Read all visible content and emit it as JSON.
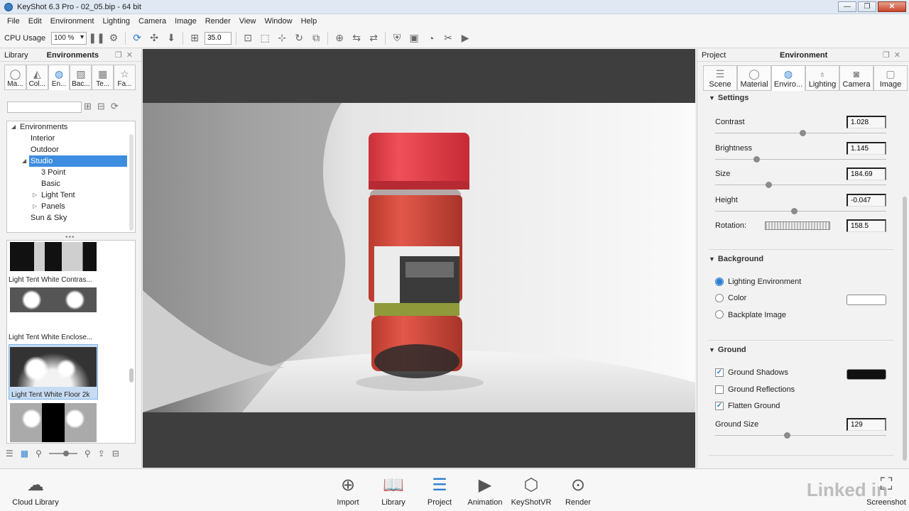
{
  "window": {
    "title": "KeyShot 6.3 Pro  - 02_05.bip  - 64 bit",
    "controls": {
      "minimize": "—",
      "maximize": "❐",
      "close": "✕"
    }
  },
  "menu": [
    "File",
    "Edit",
    "Environment",
    "Lighting",
    "Camera",
    "Image",
    "Render",
    "View",
    "Window",
    "Help"
  ],
  "toolbar": {
    "cpu_label": "CPU Usage",
    "cpu_value": "100 %",
    "focal_value": "35.0"
  },
  "library": {
    "tab_label": "Library",
    "title": "Environments",
    "tabs": [
      {
        "label": "Ma...",
        "icon": "material-icon"
      },
      {
        "label": "Col...",
        "icon": "color-icon"
      },
      {
        "label": "En...",
        "icon": "globe-icon"
      },
      {
        "label": "Bac...",
        "icon": "image-icon"
      },
      {
        "label": "Te...",
        "icon": "texture-icon"
      },
      {
        "label": "Fa...",
        "icon": "star-icon"
      }
    ],
    "search_placeholder": "",
    "tree": [
      {
        "label": "Environments",
        "level": 0,
        "twisty": "◢"
      },
      {
        "label": "Interior",
        "level": 1,
        "twisty": ""
      },
      {
        "label": "Outdoor",
        "level": 1,
        "twisty": ""
      },
      {
        "label": "Studio",
        "level": 1,
        "twisty": "◢",
        "selected": true
      },
      {
        "label": "3 Point",
        "level": 2,
        "twisty": ""
      },
      {
        "label": "Basic",
        "level": 2,
        "twisty": ""
      },
      {
        "label": "Light Tent",
        "level": 2,
        "twisty": "▷"
      },
      {
        "label": "Panels",
        "level": 2,
        "twisty": "▷"
      },
      {
        "label": "Sun & Sky",
        "level": 1,
        "twisty": ""
      }
    ],
    "thumbnails": [
      {
        "label": "Light Tent White Contras..."
      },
      {
        "label": "Light Tent White Enclose..."
      },
      {
        "label": "Light Tent White Floor 2k"
      }
    ]
  },
  "project": {
    "tab_label": "Project",
    "title": "Environment",
    "tabs": [
      {
        "label": "Scene",
        "icon": "scene-icon"
      },
      {
        "label": "Material",
        "icon": "material-icon"
      },
      {
        "label": "Enviro...",
        "icon": "globe-icon"
      },
      {
        "label": "Lighting",
        "icon": "bulb-icon"
      },
      {
        "label": "Camera",
        "icon": "camera-icon"
      },
      {
        "label": "Image",
        "icon": "image-icon"
      }
    ],
    "settings": {
      "title": "Settings",
      "contrast": {
        "label": "Contrast",
        "value": "1.028",
        "level": 0.51
      },
      "brightness": {
        "label": "Brightness",
        "value": "1.145",
        "level": 0.24
      },
      "size": {
        "label": "Size",
        "value": "184.69",
        "level": 0.31
      },
      "height": {
        "label": "Height",
        "value": "-0.047",
        "level": 0.46
      },
      "rotation": {
        "label": "Rotation:",
        "value": "158.5"
      }
    },
    "background": {
      "title": "Background",
      "options": [
        "Lighting Environment",
        "Color",
        "Backplate Image"
      ],
      "selected": "Lighting Environment",
      "color_swatch": "#ffffff"
    },
    "ground": {
      "title": "Ground",
      "shadows": {
        "label": "Ground Shadows",
        "checked": true,
        "check": "✓",
        "color": "#111111"
      },
      "reflections": {
        "label": "Ground Reflections",
        "checked": false
      },
      "flatten": {
        "label": "Flatten Ground",
        "checked": true,
        "check": "✓"
      },
      "size": {
        "label": "Ground Size",
        "value": "129",
        "level": 0.42
      }
    }
  },
  "bottom": {
    "cloud": "Cloud Library",
    "buttons": [
      "Import",
      "Library",
      "Project",
      "Animation",
      "KeyShotVR",
      "Render"
    ],
    "screenshot": "Screenshot",
    "watermark": "Linked in"
  }
}
